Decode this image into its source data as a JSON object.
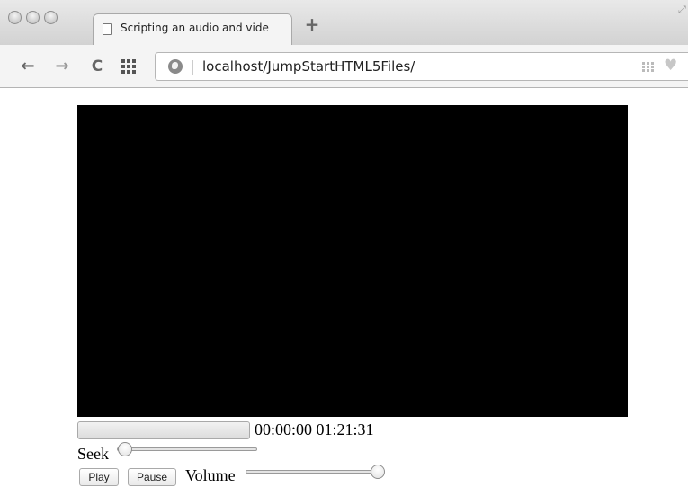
{
  "window": {
    "controls": [
      "close",
      "minimize",
      "zoom"
    ]
  },
  "tabs": [
    {
      "title": "Scripting an audio and vide",
      "favicon": "page-icon",
      "active": true
    }
  ],
  "toolbar": {
    "back_icon": "←",
    "forward_icon": "→",
    "reload_icon": "C",
    "url": "localhost/JumpStartHTML5Files/",
    "new_tab_icon": "+",
    "bookmark_icon": "♥"
  },
  "player": {
    "progress": 0,
    "current_time": "00:00:00",
    "duration": "01:21:31",
    "seek_label": "Seek",
    "seek_value": 0,
    "play_label": "Play",
    "pause_label": "Pause",
    "volume_label": "Volume",
    "volume_value": 1
  },
  "colors": {
    "video_background": "#000000",
    "page_background": "#ffffff"
  }
}
